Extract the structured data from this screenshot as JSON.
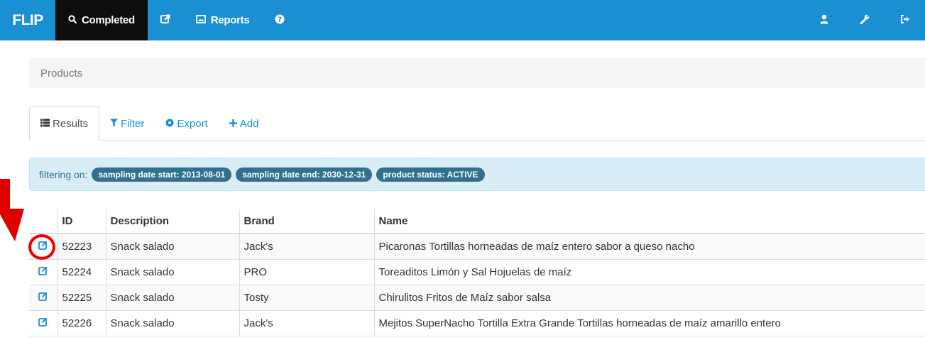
{
  "navbar": {
    "brand": "FLIP",
    "items": [
      {
        "label": "Completed",
        "icon": "search-icon",
        "active": true
      },
      {
        "label": "",
        "icon": "external-link-icon"
      },
      {
        "label": "Reports",
        "icon": "image-icon"
      },
      {
        "label": "",
        "icon": "question-circle-icon"
      }
    ],
    "right_icons": [
      "user-icon",
      "wrench-icon",
      "log-out-icon"
    ],
    "accent": "#1a8fd1"
  },
  "breadcrumb": {
    "label": "Products"
  },
  "tabs": [
    {
      "label": "Results",
      "icon": "list-icon",
      "active": true
    },
    {
      "label": "Filter",
      "icon": "filter-icon"
    },
    {
      "label": "Export",
      "icon": "export-circle-icon"
    },
    {
      "label": "Add",
      "icon": "plus-icon"
    }
  ],
  "filter": {
    "label": "filtering on:",
    "badges": [
      "sampling date start: 2013-08-01",
      "sampling date end: 2030-12-31",
      "product status: ACTIVE"
    ]
  },
  "table": {
    "columns": [
      "",
      "ID",
      "Description",
      "Brand",
      "Name"
    ],
    "rows": [
      {
        "id": "52223",
        "description": "Snack salado",
        "brand": "Jack's",
        "name": "Picaronas Tortillas horneadas de maíz entero sabor a queso nacho"
      },
      {
        "id": "52224",
        "description": "Snack salado",
        "brand": "PRO",
        "name": "Toreaditos Limón y Sal Hojuelas de maíz"
      },
      {
        "id": "52225",
        "description": "Snack salado",
        "brand": "Tosty",
        "name": "Chirulitos Fritos de Maíz sabor salsa"
      },
      {
        "id": "52226",
        "description": "Snack salado",
        "brand": "Jack's",
        "name": "Mejitos SuperNacho Tortilla Extra Grande Tortillas horneadas de maíz amarillo entero"
      }
    ]
  },
  "annotation_color": "#e00000"
}
